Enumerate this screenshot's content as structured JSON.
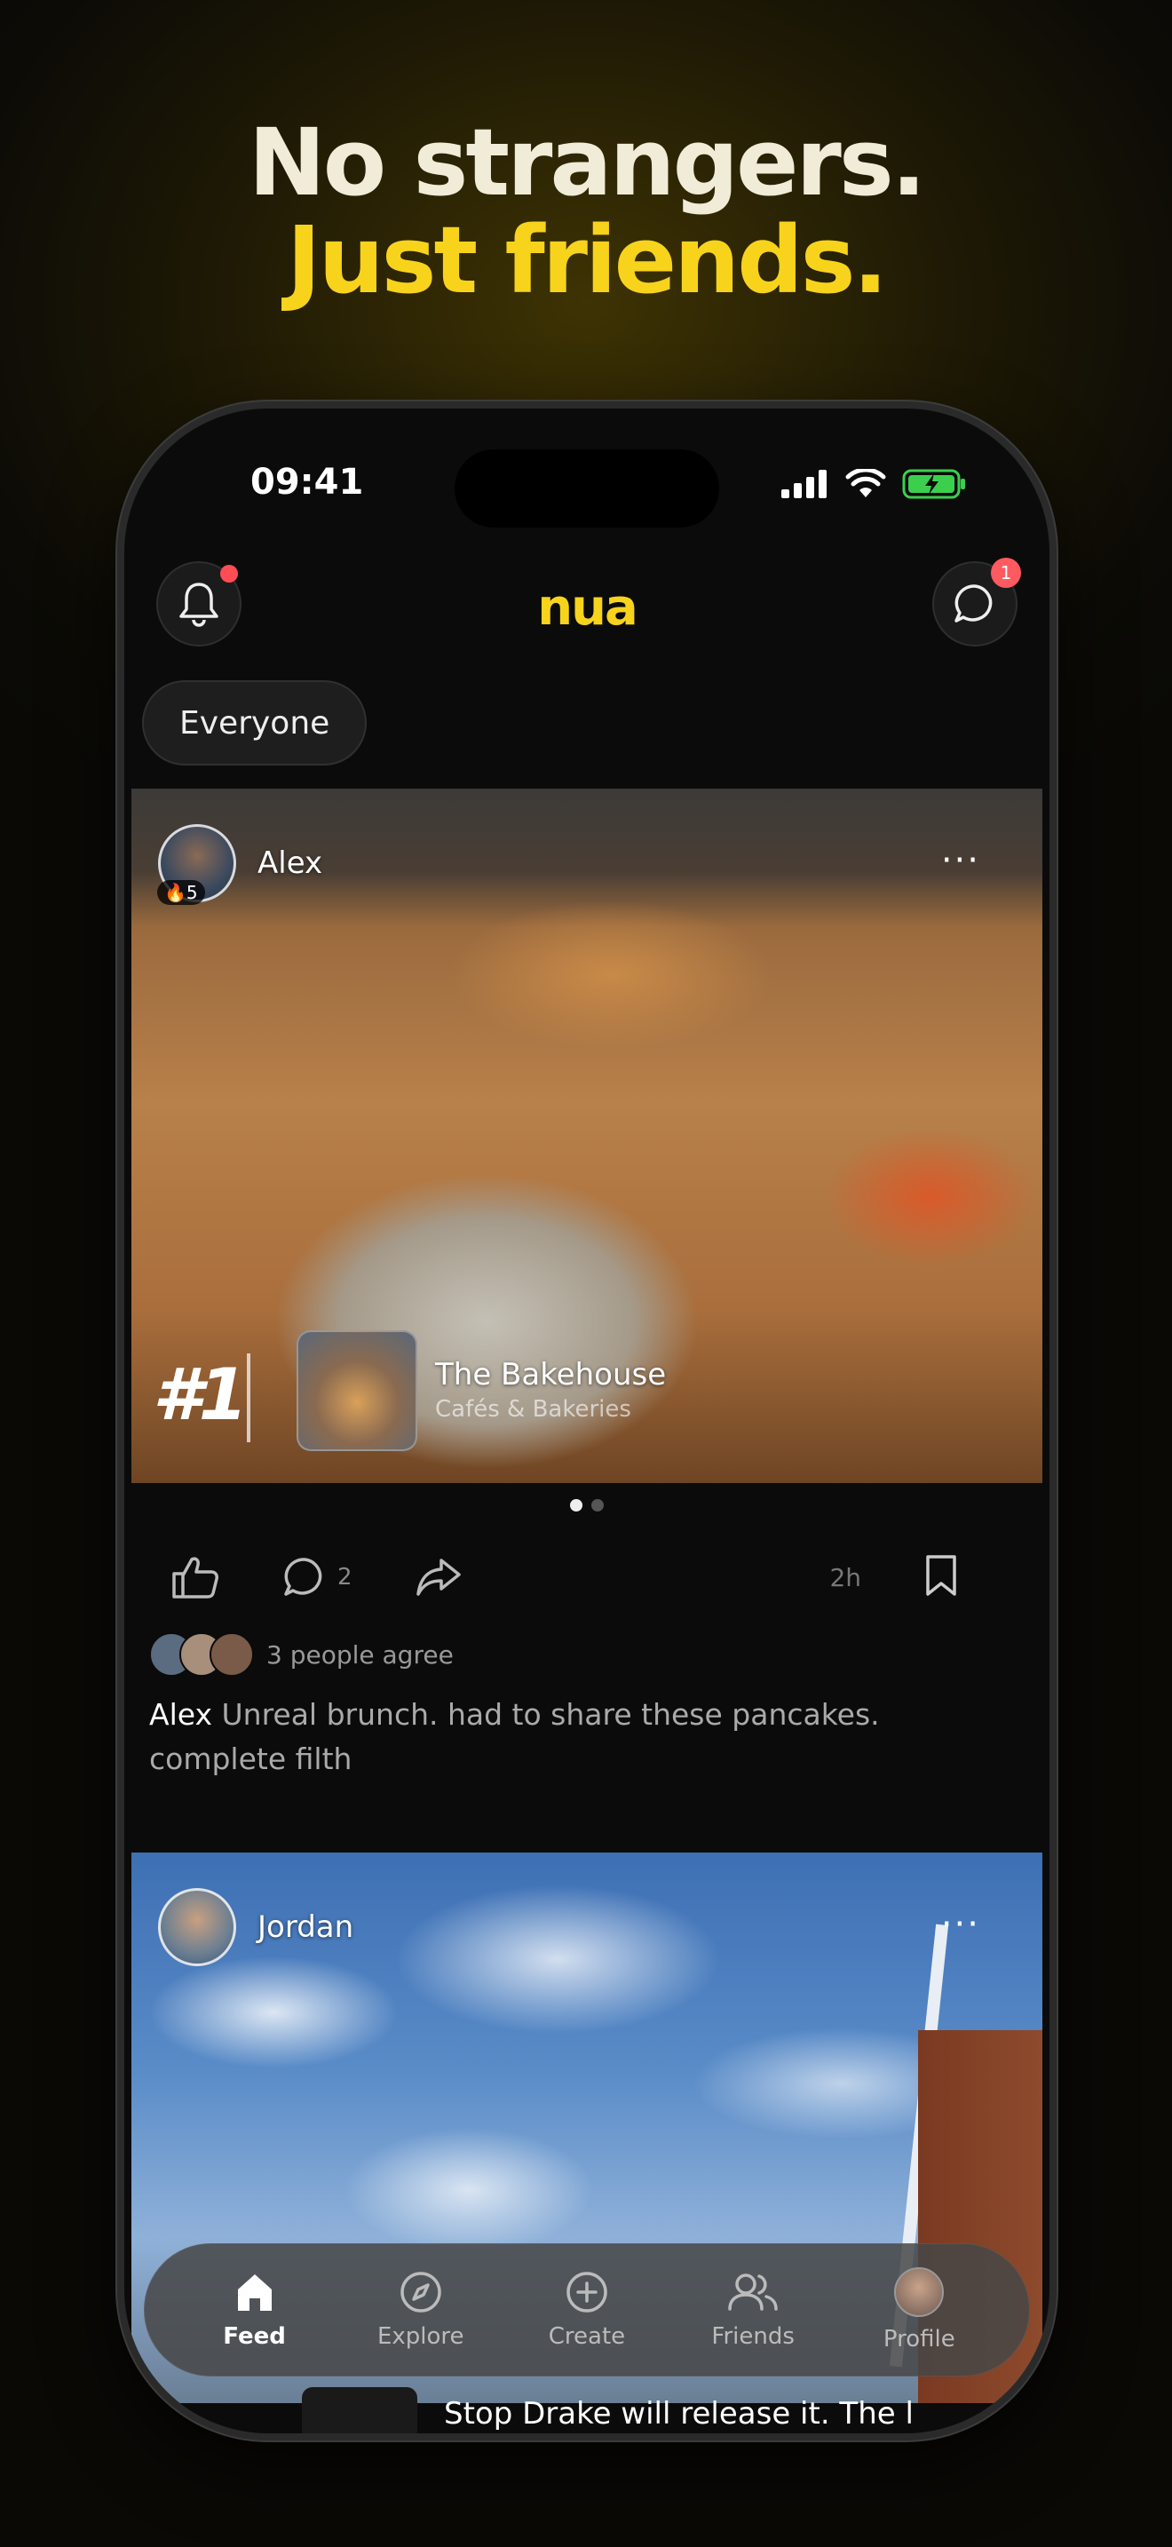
{
  "headline": {
    "line1": "No strangers.",
    "line2": "Just friends."
  },
  "status": {
    "time": "09:41"
  },
  "header": {
    "logo": "nua",
    "messages_badge": "1"
  },
  "filter": {
    "label": "Everyone"
  },
  "post1": {
    "author": "Alex",
    "streak": "🔥5",
    "more": "···",
    "rank": "#1",
    "place_name": "The Bakehouse",
    "place_category": "Cafés & Bakeries",
    "comments_count": "2",
    "time_ago": "2h",
    "agree_text": "3 people agree",
    "caption_author": "Alex",
    "caption_text": "Unreal brunch. had to share these pancakes. complete filth"
  },
  "post2": {
    "author": "Jordan",
    "more": "···",
    "peek_text": "Stop Drake will release it. The l"
  },
  "tabs": [
    {
      "label": "Feed",
      "icon": "home-icon",
      "active": true
    },
    {
      "label": "Explore",
      "icon": "compass-icon"
    },
    {
      "label": "Create",
      "icon": "plus-circle-icon"
    },
    {
      "label": "Friends",
      "icon": "friends-icon"
    },
    {
      "label": "Profile",
      "icon": "profile-avatar"
    }
  ],
  "colors": {
    "accent": "#f7d31c",
    "notification": "#ff4d55"
  }
}
